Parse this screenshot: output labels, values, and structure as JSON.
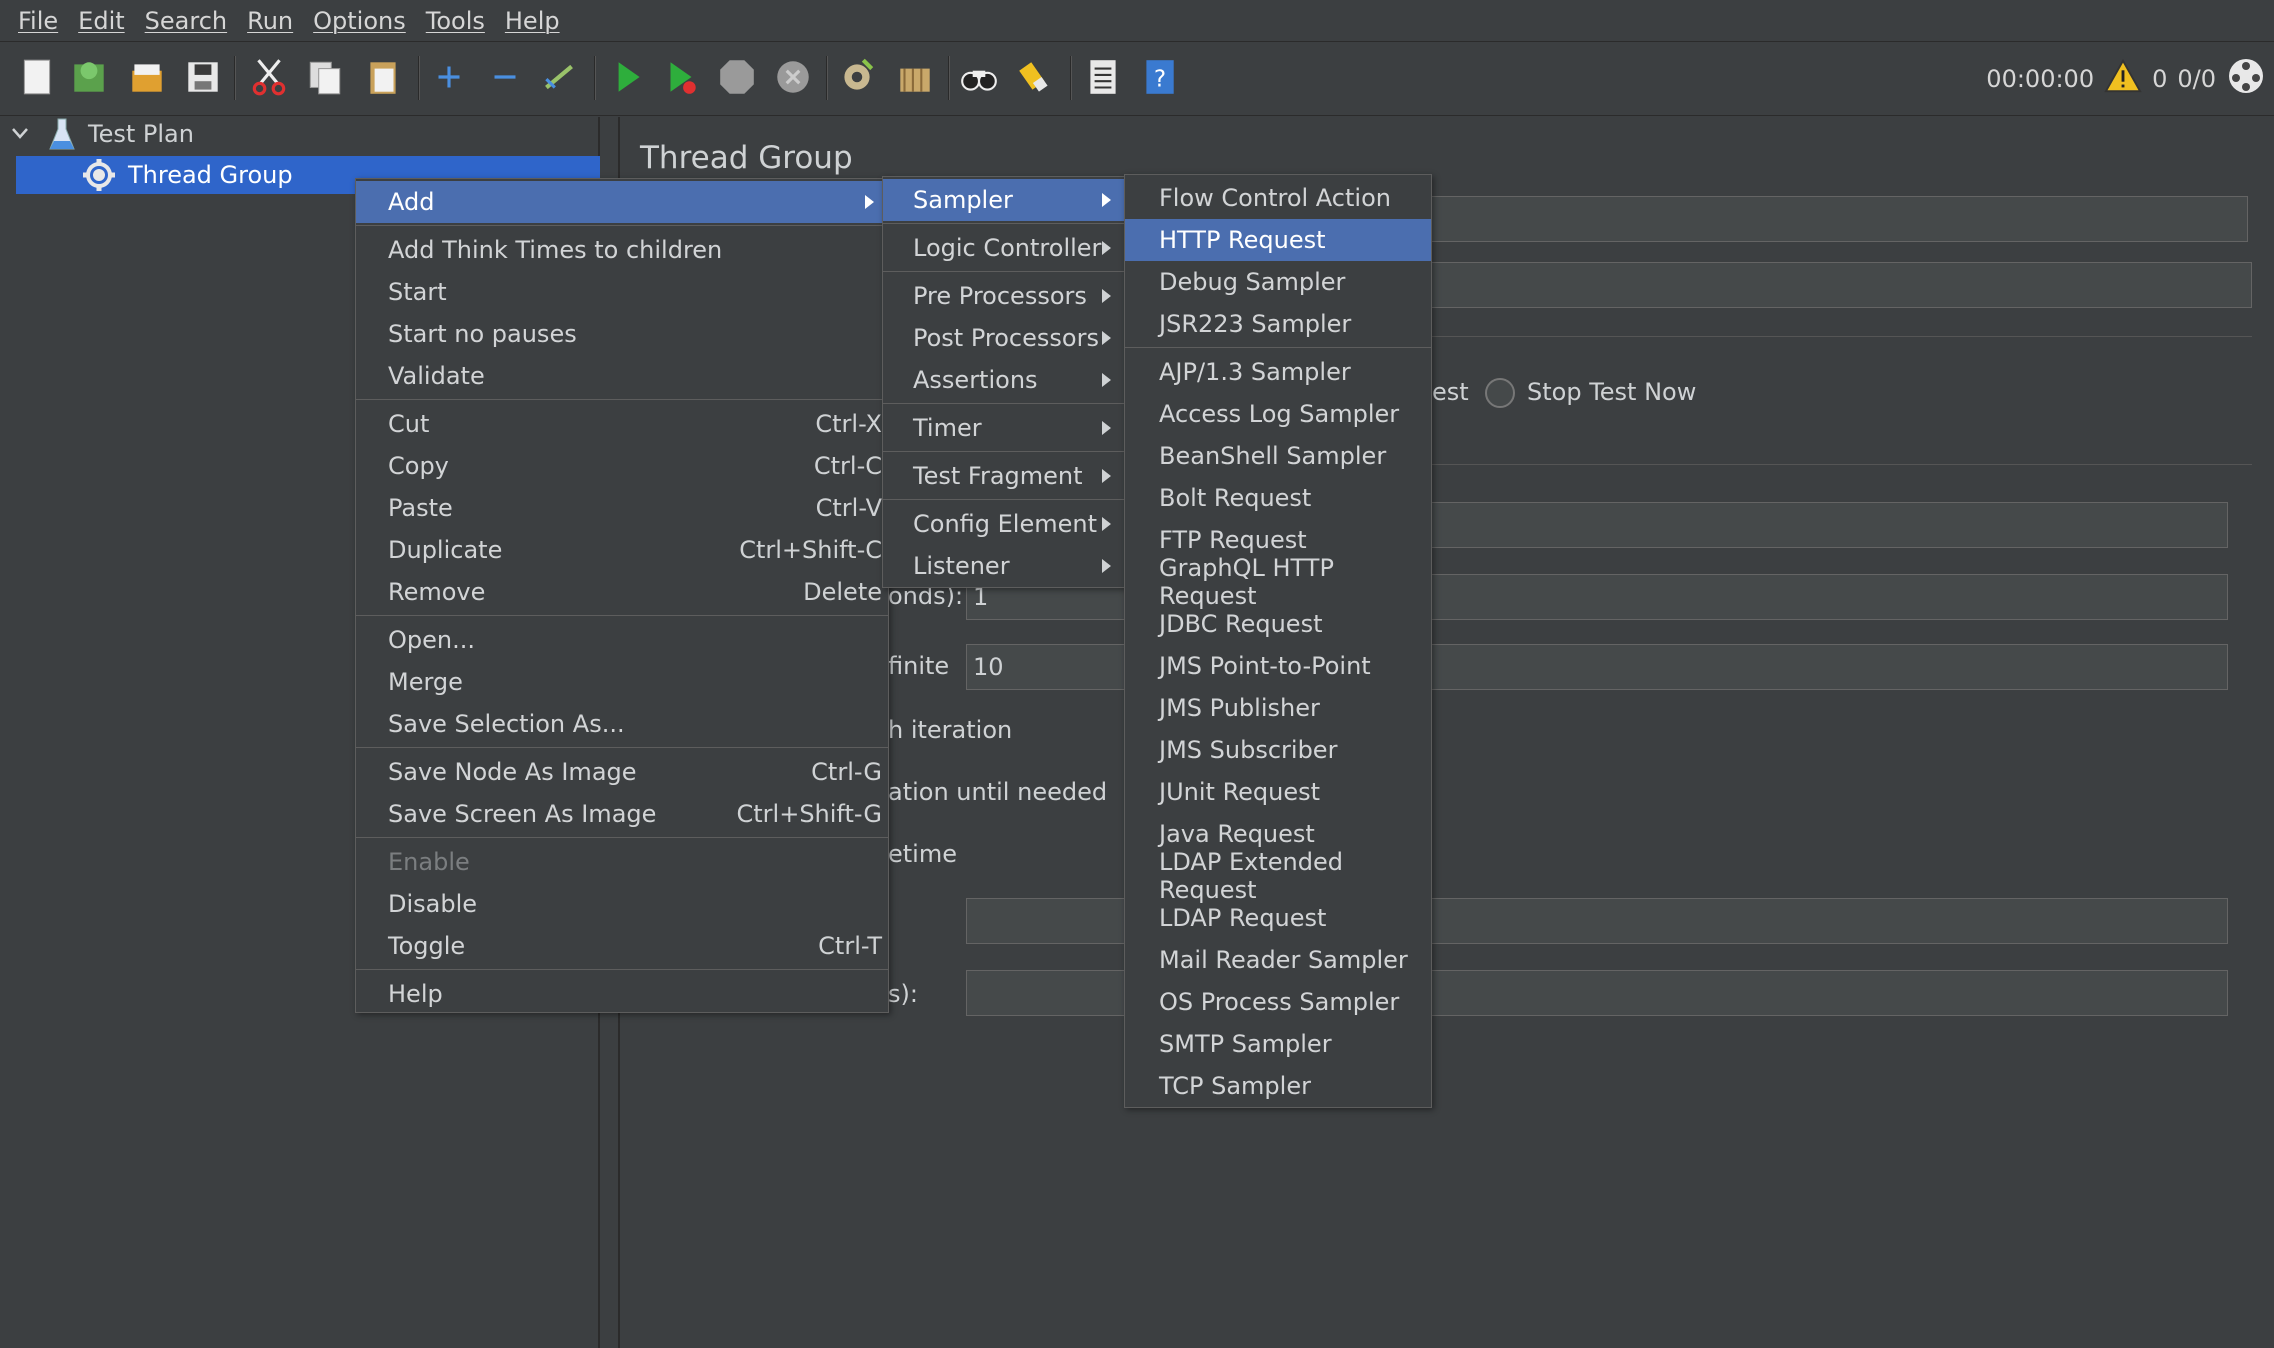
{
  "menubar": [
    "File",
    "Edit",
    "Search",
    "Run",
    "Options",
    "Tools",
    "Help"
  ],
  "toolbar": {
    "timer": "00:00:00",
    "warnings": "0",
    "threads": "0/0"
  },
  "tree": {
    "root": "Test Plan",
    "child": "Thread Group"
  },
  "panel": {
    "title": "Thread Group",
    "radio_label_partial": "est",
    "stop_test_now": "Stop Test Now",
    "seconds_label_partial": "onds):",
    "ramp_value": "1",
    "infinite_label_partial": "finite",
    "loop_value": "10",
    "each_iteration_partial": "h iteration",
    "until_needed_partial": "ation until needed",
    "lifetime_partial": "etime",
    "s_label_partial": "s):"
  },
  "context_menu": {
    "add": "Add",
    "add_think_times": "Add Think Times to children",
    "start": "Start",
    "start_no_pauses": "Start no pauses",
    "validate": "Validate",
    "cut": "Cut",
    "cut_sc": "Ctrl-X",
    "copy": "Copy",
    "copy_sc": "Ctrl-C",
    "paste": "Paste",
    "paste_sc": "Ctrl-V",
    "duplicate": "Duplicate",
    "duplicate_sc": "Ctrl+Shift-C",
    "remove": "Remove",
    "remove_sc": "Delete",
    "open": "Open...",
    "merge": "Merge",
    "save_selection": "Save Selection As...",
    "save_node_image": "Save Node As Image",
    "save_node_image_sc": "Ctrl-G",
    "save_screen_image": "Save Screen As Image",
    "save_screen_image_sc": "Ctrl+Shift-G",
    "enable": "Enable",
    "disable": "Disable",
    "toggle": "Toggle",
    "toggle_sc": "Ctrl-T",
    "help": "Help"
  },
  "add_submenu": {
    "sampler": "Sampler",
    "logic_controller": "Logic Controller",
    "pre_processors": "Pre Processors",
    "post_processors": "Post Processors",
    "assertions": "Assertions",
    "timer": "Timer",
    "test_fragment": "Test Fragment",
    "config_element": "Config Element",
    "listener": "Listener"
  },
  "sampler_submenu": {
    "flow_control_action": "Flow Control Action",
    "http_request": "HTTP Request",
    "debug_sampler": "Debug Sampler",
    "jsr223_sampler": "JSR223 Sampler",
    "ajp_sampler": "AJP/1.3 Sampler",
    "access_log_sampler": "Access Log Sampler",
    "beanshell_sampler": "BeanShell Sampler",
    "bolt_request": "Bolt Request",
    "ftp_request": "FTP Request",
    "graphql_http_request": "GraphQL HTTP Request",
    "jdbc_request": "JDBC Request",
    "jms_point_to_point": "JMS Point-to-Point",
    "jms_publisher": "JMS Publisher",
    "jms_subscriber": "JMS Subscriber",
    "junit_request": "JUnit Request",
    "java_request": "Java Request",
    "ldap_extended_request": "LDAP Extended Request",
    "ldap_request": "LDAP Request",
    "mail_reader_sampler": "Mail Reader Sampler",
    "os_process_sampler": "OS Process Sampler",
    "smtp_sampler": "SMTP Sampler",
    "tcp_sampler": "TCP Sampler"
  }
}
